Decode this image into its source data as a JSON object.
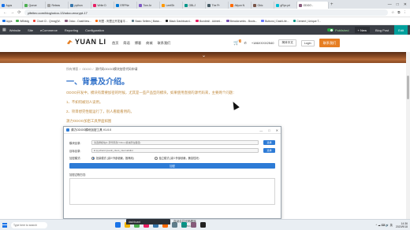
{
  "browser": {
    "tabs": [
      {
        "label": "Apps",
        "color": "#1a73e8"
      },
      {
        "label": "Queue",
        "color": "#4caf50"
      },
      {
        "label": "Releas",
        "color": "#9e9e9e"
      },
      {
        "label": "python",
        "color": "#3776ab"
      },
      {
        "label": "Write D",
        "color": "#e91e63"
      },
      {
        "label": "ERPNe",
        "color": "#0078d4"
      },
      {
        "label": "Tom Ar",
        "color": "#7e57c2"
      },
      {
        "label": "LeetSh",
        "color": "#ff9800"
      },
      {
        "label": "OBLJ",
        "color": "#009688"
      },
      {
        "label": "The Pr",
        "color": "#455a64"
      },
      {
        "label": "Aliyun N",
        "color": "#ff6a00"
      },
      {
        "label": "Gbic",
        "color": "#795548"
      },
      {
        "label": "gRpc pri",
        "color": "#00bcd4"
      },
      {
        "label": "ODOO -",
        "color": "#875a7b"
      }
    ],
    "new_tab": "+",
    "window_controls": [
      "—",
      "□",
      "✕"
    ],
    "nav": {
      "back": "←",
      "forward": "→",
      "reload": "⟳"
    },
    "url": "yifeitec.com/blog/odoo-13/odoo-encrypt-17",
    "bookmarks": [
      {
        "label": "Apps",
        "color": "#1a73e8"
      },
      {
        "label": "WBbldg",
        "color": "#4caf50"
      },
      {
        "label": "Chart Cl - Qmng(W..",
        "color": "#f44336"
      },
      {
        "label": "Odoo - DashNew...",
        "color": "#875a7b"
      },
      {
        "label": "阿里 - 阿里云开发者平...",
        "color": "#ff6a00"
      },
      {
        "label": "Basic Sellers | Basic...",
        "color": "#607d8b"
      },
      {
        "label": "Black Dashboard...",
        "color": "#212121"
      },
      {
        "label": "Bundesli - Adminl...",
        "color": "#e91e63"
      },
      {
        "label": "Breadcrumbs - Boots...",
        "color": "#7952b3"
      },
      {
        "label": "Buttons | DashLite...",
        "color": "#6576ff"
      },
      {
        "label": "Cement | Unique T...",
        "color": "#009688"
      }
    ]
  },
  "odoo_bar": {
    "apps_icon": "grid-icon",
    "items": [
      "Website",
      "Site",
      "eCommerce",
      "Reporting",
      "Configuration"
    ],
    "published_label": "Published",
    "new_label": "+ New",
    "blog_post_label": "Blog Post",
    "edit_label": "Edit"
  },
  "site": {
    "logo_text": "YUAN LI",
    "menu": [
      "首页",
      "简语",
      "博客",
      "商城",
      "联系我们"
    ],
    "cart_count": "0",
    "phone": "+186XXXX2540",
    "lang": "简体中文",
    "login": "Login",
    "contact_button": "联系我们"
  },
  "article": {
    "breadcrumb": [
      "所有博客",
      "ODOO",
      "源代码ODOO模块加密代码申请"
    ],
    "title": "一、背景及介绍。",
    "paragraphs": [
      "ODOO开发中，模块有需要加密的时候，尤其是一些产品型的模块，如果使用直接的源代码来，主要两个问题：",
      "1、不如何被别人读用。",
      "2、项目想完性能运行了，别人看能看用的。",
      "源力ODOO加密工具界面如图"
    ]
  },
  "dialog": {
    "title": "源力ODOO模块加密工具 V1.0.0",
    "controls": [
      "—",
      "□",
      "✕"
    ],
    "fields": [
      {
        "label": "模块目录:",
        "value": "请选择模块(1.源代码到/ Odoo 模块所在路径)",
        "button": "选择"
      },
      {
        "label": "目标目录:",
        "value": "E:\\pycharm\\yuanli_client_internal\\dist",
        "button": "选择"
      }
    ],
    "mode_label": "加密模式:",
    "modes": [
      {
        "label": "批量模式 (减少外部依赖，推荐用)",
        "selected": true
      },
      {
        "label": "独立模式 (减少外部依赖，兼容性好)",
        "selected": false
      }
    ],
    "convert_label": "加密",
    "log_label": "加密过程日志:"
  },
  "taskbar": {
    "search": "Type here to search",
    "notification": "dashboard",
    "notification_text": "自动合并代码程序",
    "notification_sub": "2020/9/18",
    "apps": [
      "#1a73e8",
      "#f0b400",
      "#4caf50",
      "#e91e63",
      "#3776ab",
      "#ff6a00",
      "#607d8b",
      "#009688",
      "#875a7b",
      "#212121"
    ],
    "tray_icons": "^ ☁ ⌨ 🔊 英",
    "time": "14:36",
    "date": "2020/9/18"
  }
}
